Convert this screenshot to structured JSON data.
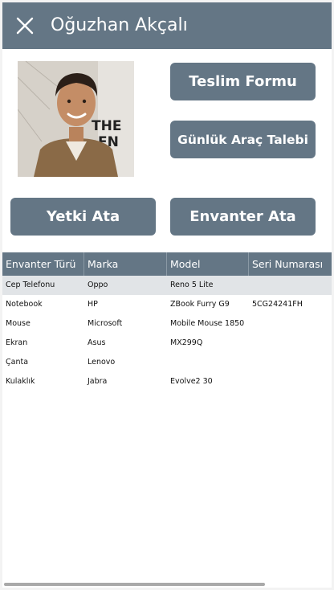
{
  "header": {
    "title": "Oğuzhan Akçalı",
    "close_icon": "close-icon"
  },
  "profile": {
    "photo": "profile-photo"
  },
  "buttons": {
    "teslim_formu": "Teslim Formu",
    "gunluk_arac_talebi": "Günlük Araç Talebi",
    "yetki_ata": "Yetki Ata",
    "envanter_ata": "Envanter Ata"
  },
  "colors": {
    "accent": "#647685",
    "selected_row": "#e1e4e7"
  },
  "table": {
    "columns": [
      "Envanter Türü",
      "Marka",
      "Model",
      "Seri Numarası"
    ],
    "rows": [
      [
        "Cep Telefonu",
        "Oppo",
        "Reno 5 Lite",
        ""
      ],
      [
        "Notebook",
        "HP",
        "ZBook Furry G9",
        "5CG24241FH"
      ],
      [
        "Mouse",
        "Microsoft",
        "Mobile Mouse 1850",
        ""
      ],
      [
        "Ekran",
        "Asus",
        "MX299Q",
        ""
      ],
      [
        "Çanta",
        "Lenovo",
        "",
        ""
      ],
      [
        "Kulaklık",
        "Jabra",
        "Evolve2 30",
        ""
      ]
    ],
    "selected_row": 0
  }
}
